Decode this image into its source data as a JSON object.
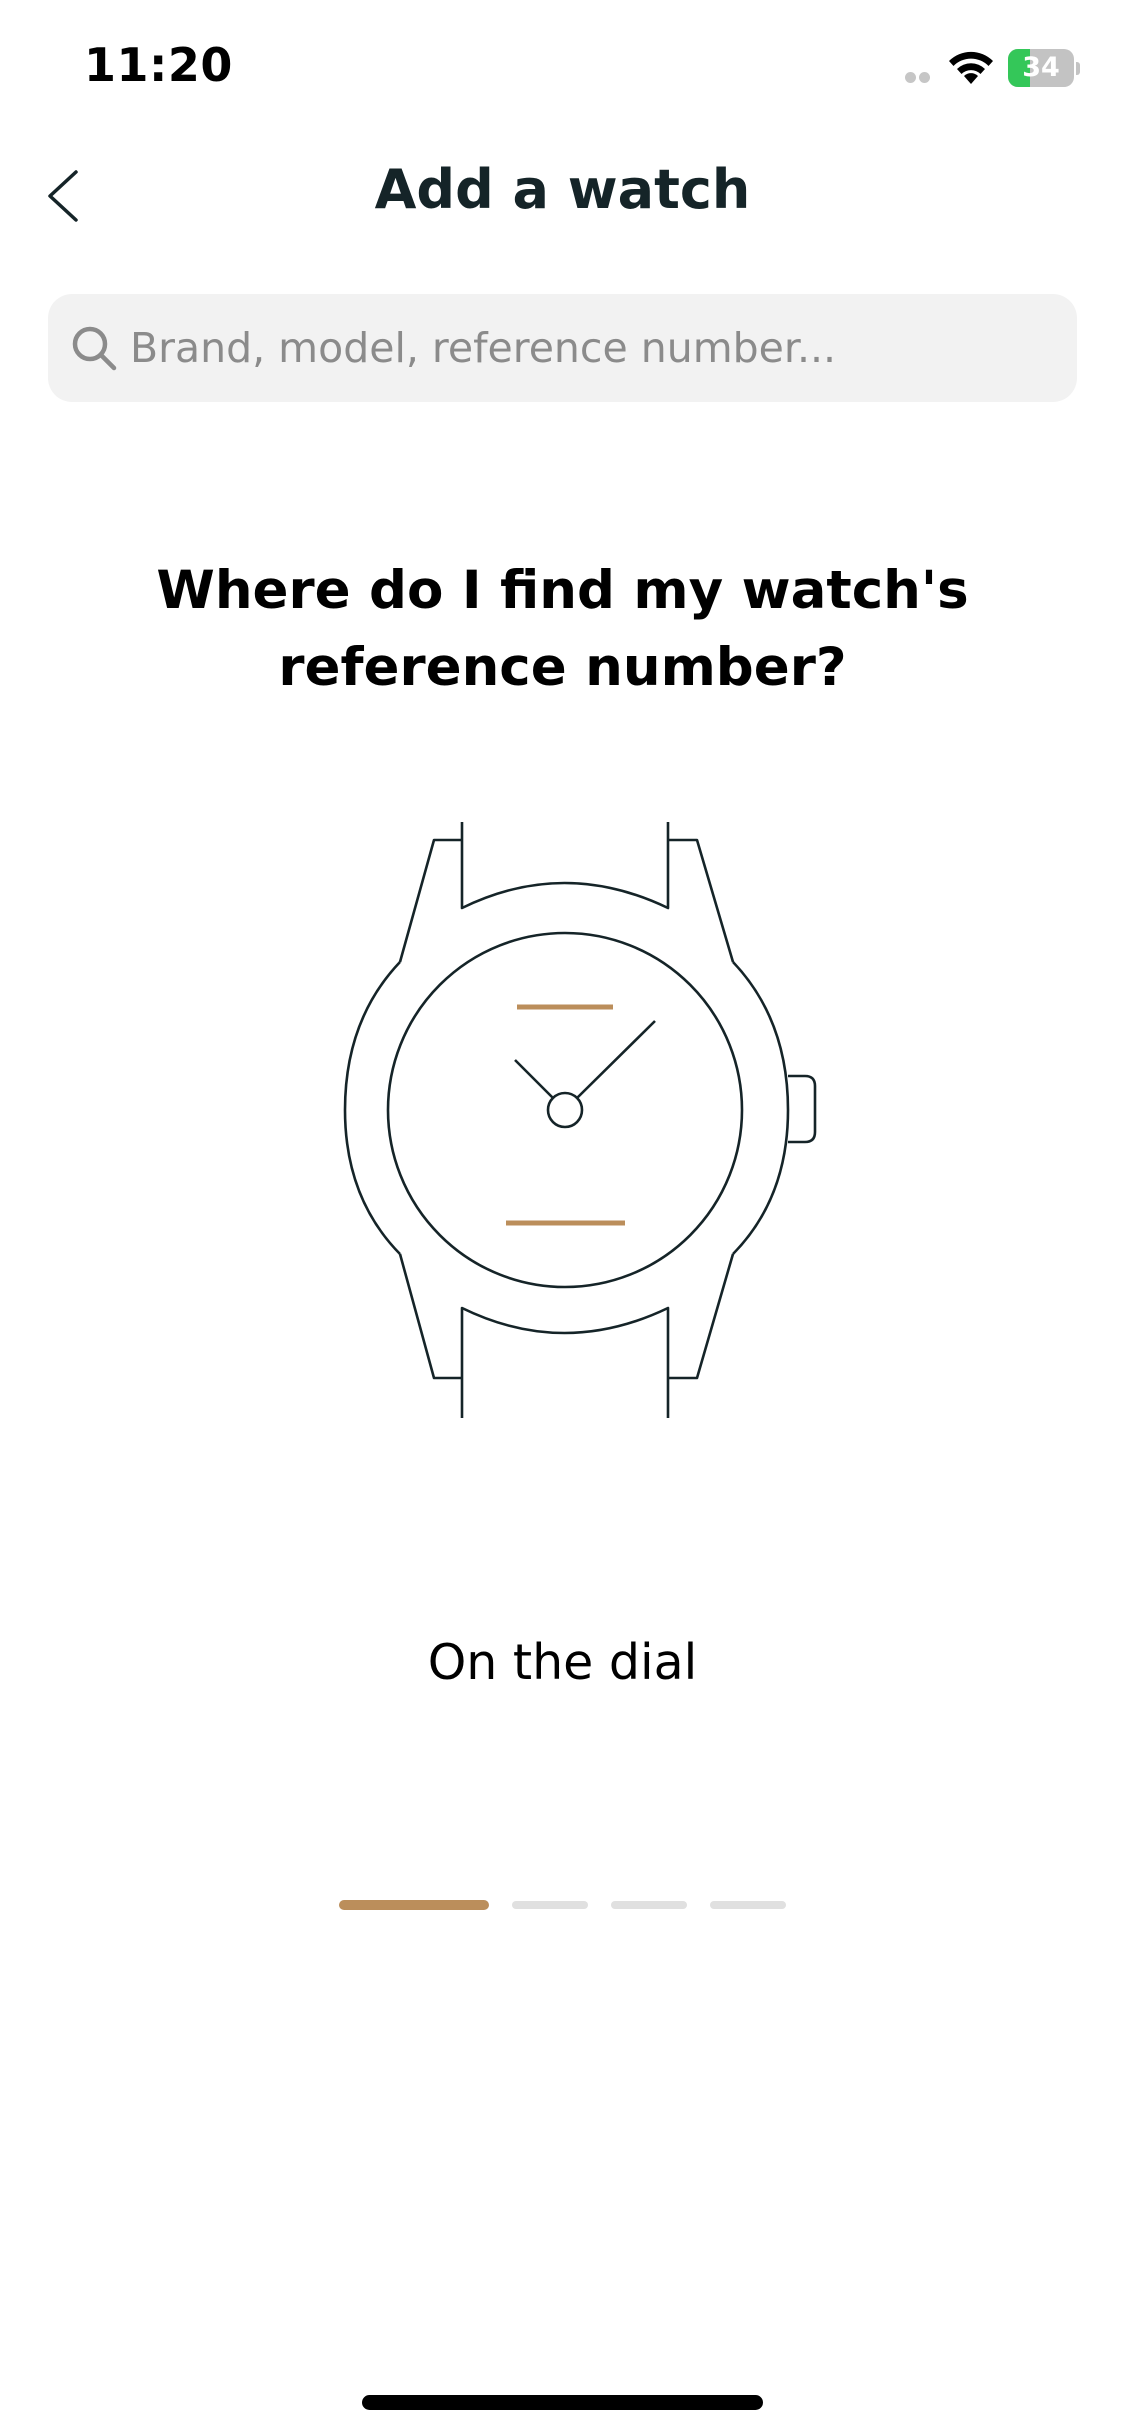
{
  "status_bar": {
    "time": "11:20",
    "battery_level": "34",
    "battery_percent": 34,
    "battery_color": "#34c759"
  },
  "nav": {
    "title": "Add a watch",
    "back_icon": "chevron-left-icon"
  },
  "search": {
    "placeholder": "Brand, model, reference number...",
    "value": "",
    "icon": "search-icon"
  },
  "help": {
    "heading": "Where do I find my watch's reference number?"
  },
  "carousel": {
    "caption": "On the dial",
    "total_pages": 4,
    "current_page": 1,
    "accent_color": "#bb8e5b",
    "inactive_color": "#e0e0e0"
  },
  "illustration": {
    "icon": "wristwatch-icon",
    "line_color": "#152428",
    "highlight_color": "#bb8e5b"
  }
}
